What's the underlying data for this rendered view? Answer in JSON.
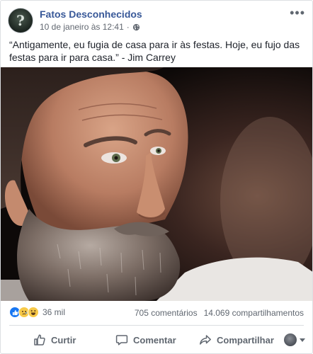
{
  "post": {
    "page_name": "Fatos Desconhecidos",
    "timestamp": "10 de janeiro às 12:41",
    "separator": "·",
    "privacy_icon": "globe-icon",
    "more_icon": "ellipsis-icon",
    "caption": "“Antigamente, eu fugia de casa para ir às festas. Hoje, eu fujo das festas para ir para casa.” - Jim Carrey"
  },
  "reactions": {
    "types": [
      "like",
      "sad",
      "haha"
    ],
    "count": "36 mil"
  },
  "stats": {
    "comments": "705 comentários",
    "shares": "14.069 compartilhamentos"
  },
  "actions": {
    "like_label": "Curtir",
    "comment_label": "Comentar",
    "share_label": "Compartilhar"
  },
  "colors": {
    "link": "#385898",
    "secondary_text": "#606770",
    "like_blue": "#1877f2",
    "emoji_yellow": "#f7c948"
  }
}
